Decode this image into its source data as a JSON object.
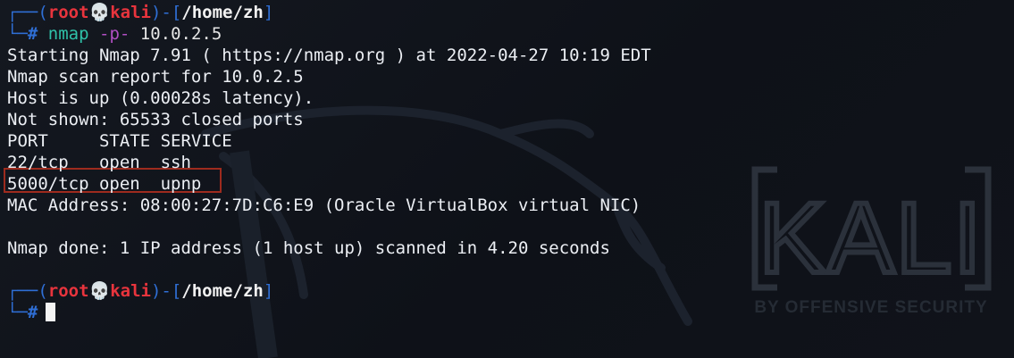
{
  "prompt1": {
    "frame_open": "┌──(",
    "user": "root",
    "skull": "💀",
    "host": "kali",
    "frame_mid": ")-[",
    "cwd": "/home/zh",
    "frame_close": "]",
    "frame_lower": "└─",
    "hash": "#",
    "command": "nmap",
    "option": "-p-",
    "target": "10.0.2.5"
  },
  "output": [
    "Starting Nmap 7.91 ( https://nmap.org ) at 2022-04-27 10:19 EDT",
    "Nmap scan report for 10.0.2.5",
    "Host is up (0.00028s latency).",
    "Not shown: 65533 closed ports",
    "PORT     STATE SERVICE",
    "22/tcp   open  ssh",
    "5000/tcp open  upnp",
    "MAC Address: 08:00:27:7D:C6:E9 (Oracle VirtualBox virtual NIC)",
    "",
    "Nmap done: 1 IP address (1 host up) scanned in 4.20 seconds"
  ],
  "prompt2": {
    "frame_open": "┌──(",
    "user": "root",
    "skull": "💀",
    "host": "kali",
    "frame_mid": ")-[",
    "cwd": "/home/zh",
    "frame_close": "]",
    "frame_lower": "└─",
    "hash": "#"
  },
  "background": {
    "logo_text": "KALI",
    "tagline": "BY OFFENSIVE SECURITY"
  },
  "colors": {
    "background": "#0f1219",
    "prompt_frame": "#2f6fd6",
    "root_user": "#e8343d",
    "command": "#2fc1a8",
    "option": "#b24fc4",
    "highlight_box": "#9e2b1e"
  }
}
